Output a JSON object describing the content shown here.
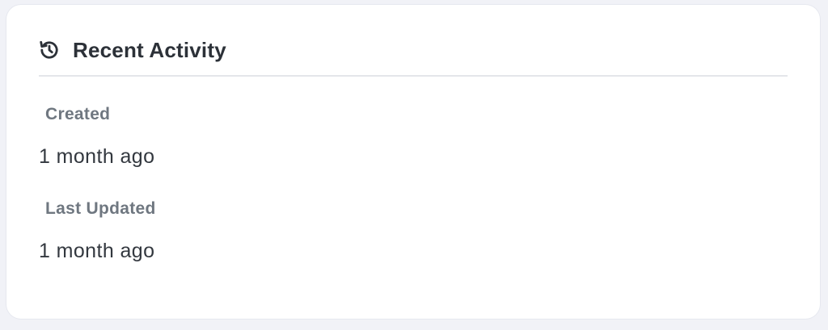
{
  "card": {
    "title": "Recent Activity",
    "icon": "history-icon",
    "fields": [
      {
        "label": "Created",
        "value": "1 month ago"
      },
      {
        "label": "Last Updated",
        "value": "1 month ago"
      }
    ]
  },
  "colors": {
    "background": "#f1f2f7",
    "card": "#ffffff",
    "title": "#2c3138",
    "label": "#6f7780",
    "value": "#33383f",
    "divider": "#e4e6ea"
  }
}
